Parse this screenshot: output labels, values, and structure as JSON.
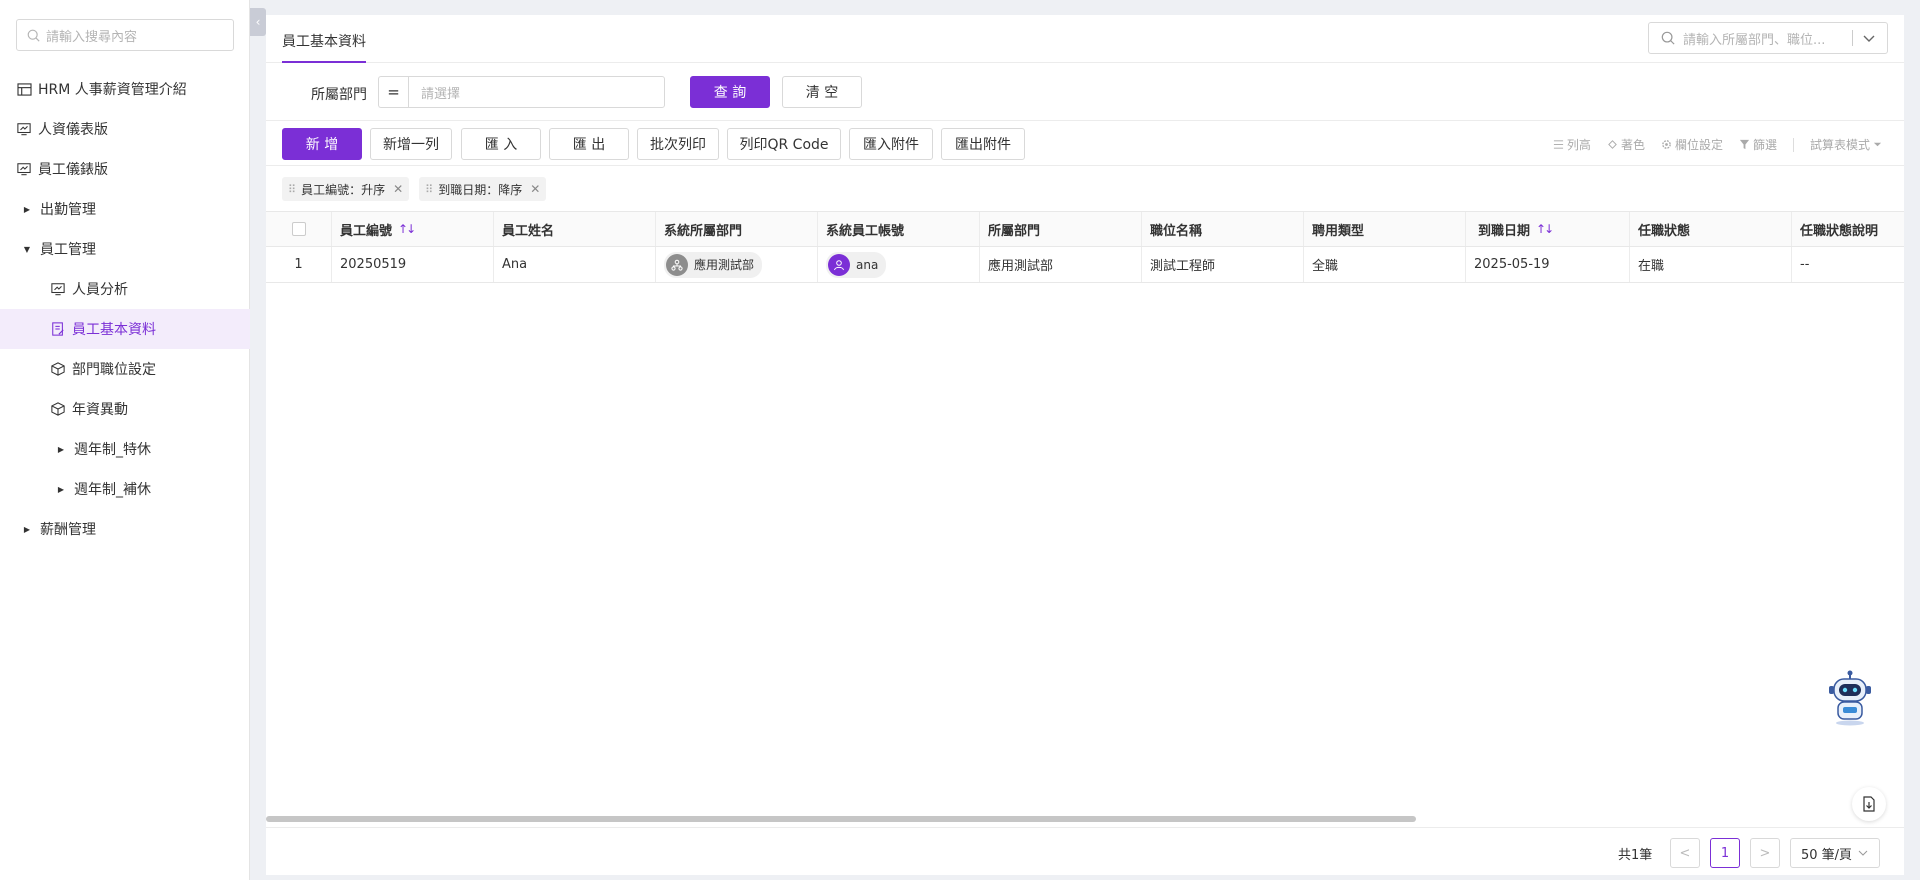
{
  "sidebar": {
    "search_placeholder": "請輸入搜尋內容",
    "collapse_glyph": "‹",
    "items": [
      {
        "label": "HRM 人事薪資管理介紹",
        "icon": "table-icon"
      },
      {
        "label": "人資儀表版",
        "icon": "dashboard-icon"
      },
      {
        "label": "員工儀錶版",
        "icon": "dashboard-icon"
      },
      {
        "label": "出勤管理",
        "icon": "caret-right-icon"
      },
      {
        "label": "員工管理",
        "icon": "caret-down-icon"
      },
      {
        "label": "人員分析",
        "icon": "dashboard-icon"
      },
      {
        "label": "員工基本資料",
        "icon": "form-icon",
        "active": true
      },
      {
        "label": "部門職位設定",
        "icon": "cube-icon"
      },
      {
        "label": "年資異動",
        "icon": "cube-icon"
      },
      {
        "label": "週年制_特休",
        "icon": "caret-right-icon"
      },
      {
        "label": "週年制_補休",
        "icon": "caret-right-icon"
      },
      {
        "label": "薪酬管理",
        "icon": "caret-right-icon"
      }
    ]
  },
  "header": {
    "tab_label": "員工基本資料",
    "search_placeholder": "請輸入所屬部門、職位..."
  },
  "filter": {
    "label": "所屬部門",
    "operator": "=",
    "select_placeholder": "請選擇",
    "query_label": "查 詢",
    "clear_label": "清 空"
  },
  "toolbar": {
    "add": "新 增",
    "add_row": "新增一列",
    "import": "匯 入",
    "export": "匯 出",
    "batch_print": "批次列印",
    "print_qr": "列印QR Code",
    "import_attach": "匯入附件",
    "export_attach": "匯出附件",
    "right": {
      "row_height": "列高",
      "color": "著色",
      "column_settings": "欄位設定",
      "filter": "篩選",
      "sheet_mode": "試算表模式"
    }
  },
  "sort_chips": [
    {
      "label": "員工編號：升序"
    },
    {
      "label": "到職日期：降序"
    }
  ],
  "table": {
    "columns": [
      "員工編號",
      "員工姓名",
      "系統所屬部門",
      "系統員工帳號",
      "所屬部門",
      "職位名稱",
      "聘用類型",
      "到職日期",
      "任職狀態",
      "任職狀態說明"
    ],
    "rows": [
      {
        "index": "1",
        "employee_id": "20250519",
        "name": "Ana",
        "sys_dept": "應用測試部",
        "sys_account": "ana",
        "dept": "應用測試部",
        "position": "測試工程師",
        "hire_type": "全職",
        "hire_date": "2025-05-19",
        "status": "在職",
        "status_desc": "--"
      }
    ]
  },
  "pager": {
    "total": "共1筆",
    "prev": "<",
    "current": "1",
    "next": ">",
    "page_size": "50 筆/頁"
  },
  "colors": {
    "accent": "#7b2fd6"
  }
}
